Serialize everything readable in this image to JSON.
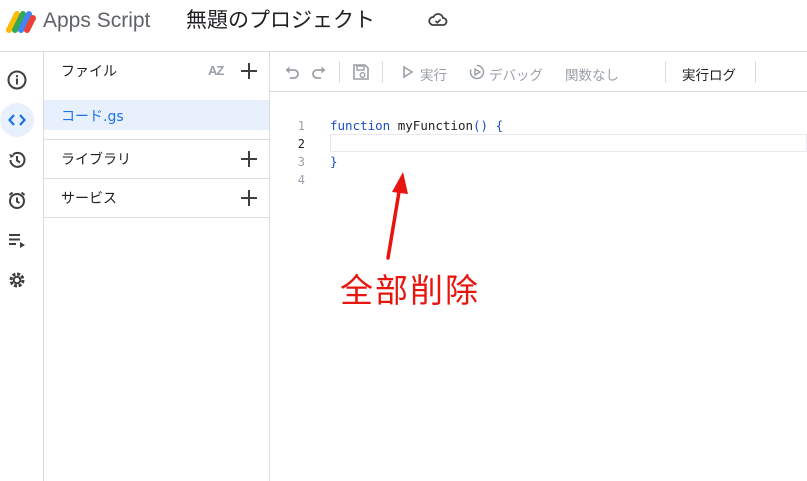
{
  "header": {
    "app_name": "Apps Script",
    "project_title": "無題のプロジェクト",
    "logo_icon": "apps-script-logo",
    "cloud_icon": "cloud-saved-icon"
  },
  "rail": {
    "items": [
      {
        "name": "overview",
        "icon": "info-icon",
        "active": false
      },
      {
        "name": "editor",
        "icon": "code-icon",
        "active": true
      },
      {
        "name": "history",
        "icon": "history-icon",
        "active": false
      },
      {
        "name": "triggers",
        "icon": "alarm-icon",
        "active": false
      },
      {
        "name": "executions",
        "icon": "playlist-play-icon",
        "active": false
      },
      {
        "name": "settings",
        "icon": "gear-icon",
        "active": false
      }
    ]
  },
  "files_panel": {
    "files_label": "ファイル",
    "sort_label": "AZ",
    "file_name": "コード.gs",
    "libraries_label": "ライブラリ",
    "services_label": "サービス"
  },
  "toolbar": {
    "run_label": "実行",
    "debug_label": "デバッグ",
    "function_label": "関数なし",
    "log_label": "実行ログ"
  },
  "editor": {
    "line_numbers": [
      "1",
      "2",
      "3",
      "4"
    ],
    "line1_keyword": "function",
    "line1_name": " myFunction",
    "line1_punc": "() {",
    "line3": "}"
  },
  "annotation": {
    "text": "全部削除",
    "color": "#e8150e"
  },
  "colors": {
    "accent": "#1a73e8",
    "active_bg": "#e8f0fe",
    "border": "#dadce0"
  }
}
